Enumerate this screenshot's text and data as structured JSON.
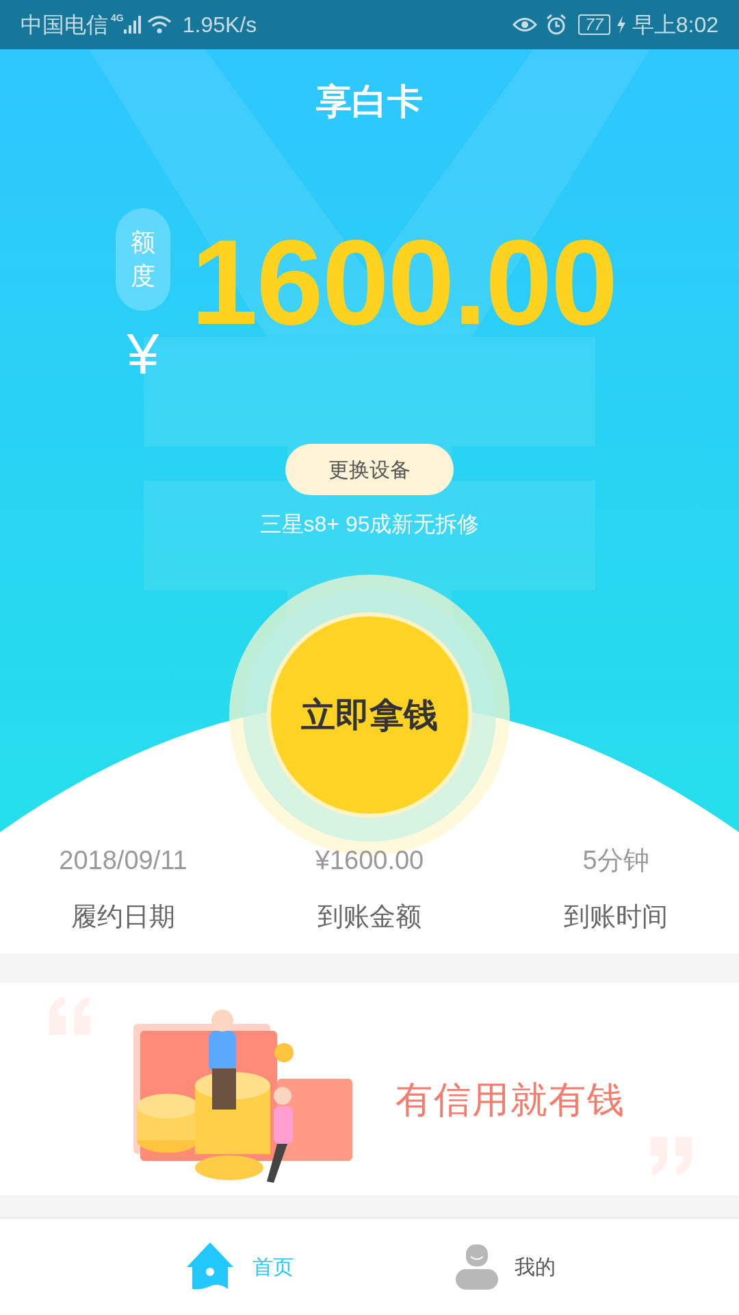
{
  "status_bar": {
    "carrier": "中国电信",
    "network": "4G",
    "speed": "1.95K/s",
    "battery": "77",
    "time": "早上8:02"
  },
  "header": {
    "title": "享白卡"
  },
  "credit": {
    "label": "额度",
    "currency": "¥",
    "amount": "1600.00"
  },
  "device": {
    "button": "更换设备",
    "name": "三星s8+ 95成新无拆修"
  },
  "main_button": "立即拿钱",
  "stats": [
    {
      "value": "2018/09/11",
      "label": "履约日期"
    },
    {
      "value": "¥1600.00",
      "label": "到账金额"
    },
    {
      "value": "5分钟",
      "label": "到账时间"
    }
  ],
  "banner": {
    "slogan": "有信用就有钱"
  },
  "nav": [
    {
      "kind": "home",
      "label": "首页",
      "selected": true
    },
    {
      "kind": "profile",
      "label": "我的",
      "selected": false
    }
  ]
}
